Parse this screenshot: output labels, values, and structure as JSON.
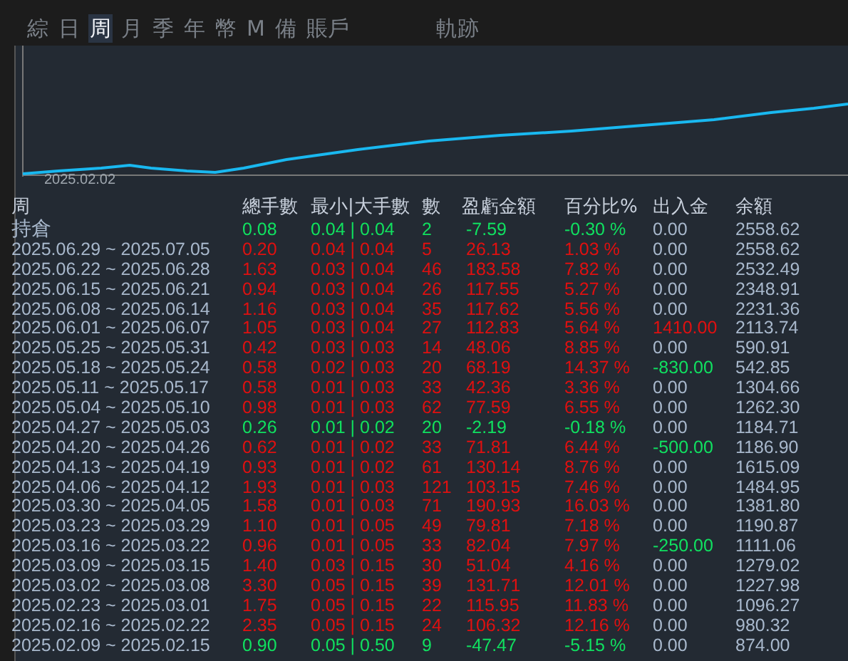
{
  "tabs": [
    {
      "label": "綜",
      "selected": false
    },
    {
      "label": "日",
      "selected": false
    },
    {
      "label": "周",
      "selected": true
    },
    {
      "label": "月",
      "selected": false
    },
    {
      "label": "季",
      "selected": false
    },
    {
      "label": "年",
      "selected": false
    },
    {
      "label": "幣",
      "selected": false
    },
    {
      "label": "M",
      "selected": false
    },
    {
      "label": "備",
      "selected": false
    },
    {
      "label": "賬戶",
      "selected": false
    },
    {
      "label": "軌跡",
      "selected": false
    }
  ],
  "chart": {
    "x_label": "2025.02.02"
  },
  "table": {
    "period_heading": "周",
    "columns": [
      "總手數",
      "最小|大手數",
      "數",
      "盈虧金額",
      "百分比%",
      "出入金",
      "余額"
    ],
    "rows": [
      {
        "week": "持倉",
        "total": "0.08",
        "min_max": "0.04 | 0.04",
        "count": "2",
        "pnl": "-7.59",
        "pct": "-0.30 %",
        "deposit": {
          "value": "0.00",
          "color": "#a8b8cc"
        },
        "balance": "2558.62",
        "color": "#10e060"
      },
      {
        "week": "2025.06.29 ~ 2025.07.05",
        "total": "0.20",
        "min_max": "0.04 | 0.04",
        "count": "5",
        "pnl": "26.13",
        "pct": "1.03 %",
        "deposit": {
          "value": "0.00",
          "color": "#a8b8cc"
        },
        "balance": "2558.62",
        "color": "#e01010"
      },
      {
        "week": "2025.06.22 ~ 2025.06.28",
        "total": "1.63",
        "min_max": "0.03 | 0.04",
        "count": "46",
        "pnl": "183.58",
        "pct": "7.82 %",
        "deposit": {
          "value": "0.00",
          "color": "#a8b8cc"
        },
        "balance": "2532.49",
        "color": "#e01010"
      },
      {
        "week": "2025.06.15 ~ 2025.06.21",
        "total": "0.94",
        "min_max": "0.03 | 0.04",
        "count": "26",
        "pnl": "117.55",
        "pct": "5.27 %",
        "deposit": {
          "value": "0.00",
          "color": "#a8b8cc"
        },
        "balance": "2348.91",
        "color": "#e01010"
      },
      {
        "week": "2025.06.08 ~ 2025.06.14",
        "total": "1.16",
        "min_max": "0.03 | 0.04",
        "count": "35",
        "pnl": "117.62",
        "pct": "5.56 %",
        "deposit": {
          "value": "0.00",
          "color": "#a8b8cc"
        },
        "balance": "2231.36",
        "color": "#e01010"
      },
      {
        "week": "2025.06.01 ~ 2025.06.07",
        "total": "1.05",
        "min_max": "0.03 | 0.04",
        "count": "27",
        "pnl": "112.83",
        "pct": "5.64 %",
        "deposit": {
          "value": "1410.00",
          "color": "#e01010"
        },
        "balance": "2113.74",
        "color": "#e01010"
      },
      {
        "week": "2025.05.25 ~ 2025.05.31",
        "total": "0.42",
        "min_max": "0.03 | 0.03",
        "count": "14",
        "pnl": "48.06",
        "pct": "8.85 %",
        "deposit": {
          "value": "0.00",
          "color": "#a8b8cc"
        },
        "balance": "590.91",
        "color": "#e01010"
      },
      {
        "week": "2025.05.18 ~ 2025.05.24",
        "total": "0.58",
        "min_max": "0.02 | 0.03",
        "count": "20",
        "pnl": "68.19",
        "pct": "14.37 %",
        "deposit": {
          "value": "-830.00",
          "color": "#10e060"
        },
        "balance": "542.85",
        "color": "#e01010"
      },
      {
        "week": "2025.05.11 ~ 2025.05.17",
        "total": "0.58",
        "min_max": "0.01 | 0.03",
        "count": "33",
        "pnl": "42.36",
        "pct": "3.36 %",
        "deposit": {
          "value": "0.00",
          "color": "#a8b8cc"
        },
        "balance": "1304.66",
        "color": "#e01010"
      },
      {
        "week": "2025.05.04 ~ 2025.05.10",
        "total": "0.98",
        "min_max": "0.01 | 0.03",
        "count": "62",
        "pnl": "77.59",
        "pct": "6.55 %",
        "deposit": {
          "value": "0.00",
          "color": "#a8b8cc"
        },
        "balance": "1262.30",
        "color": "#e01010"
      },
      {
        "week": "2025.04.27 ~ 2025.05.03",
        "total": "0.26",
        "min_max": "0.01 | 0.02",
        "count": "20",
        "pnl": "-2.19",
        "pct": "-0.18 %",
        "deposit": {
          "value": "0.00",
          "color": "#a8b8cc"
        },
        "balance": "1184.71",
        "color": "#10e060"
      },
      {
        "week": "2025.04.20 ~ 2025.04.26",
        "total": "0.62",
        "min_max": "0.01 | 0.02",
        "count": "33",
        "pnl": "71.81",
        "pct": "6.44 %",
        "deposit": {
          "value": "-500.00",
          "color": "#10e060"
        },
        "balance": "1186.90",
        "color": "#e01010"
      },
      {
        "week": "2025.04.13 ~ 2025.04.19",
        "total": "0.93",
        "min_max": "0.01 | 0.02",
        "count": "61",
        "pnl": "130.14",
        "pct": "8.76 %",
        "deposit": {
          "value": "0.00",
          "color": "#a8b8cc"
        },
        "balance": "1615.09",
        "color": "#e01010"
      },
      {
        "week": "2025.04.06 ~ 2025.04.12",
        "total": "1.93",
        "min_max": "0.01 | 0.03",
        "count": "121",
        "pnl": "103.15",
        "pct": "7.46 %",
        "deposit": {
          "value": "0.00",
          "color": "#a8b8cc"
        },
        "balance": "1484.95",
        "color": "#e01010"
      },
      {
        "week": "2025.03.30 ~ 2025.04.05",
        "total": "1.58",
        "min_max": "0.01 | 0.03",
        "count": "71",
        "pnl": "190.93",
        "pct": "16.03 %",
        "deposit": {
          "value": "0.00",
          "color": "#a8b8cc"
        },
        "balance": "1381.80",
        "color": "#e01010"
      },
      {
        "week": "2025.03.23 ~ 2025.03.29",
        "total": "1.10",
        "min_max": "0.01 | 0.05",
        "count": "49",
        "pnl": "79.81",
        "pct": "7.18 %",
        "deposit": {
          "value": "0.00",
          "color": "#a8b8cc"
        },
        "balance": "1190.87",
        "color": "#e01010"
      },
      {
        "week": "2025.03.16 ~ 2025.03.22",
        "total": "0.96",
        "min_max": "0.01 | 0.05",
        "count": "33",
        "pnl": "82.04",
        "pct": "7.97 %",
        "deposit": {
          "value": "-250.00",
          "color": "#10e060"
        },
        "balance": "1111.06",
        "color": "#e01010"
      },
      {
        "week": "2025.03.09 ~ 2025.03.15",
        "total": "1.40",
        "min_max": "0.03 | 0.15",
        "count": "30",
        "pnl": "51.04",
        "pct": "4.16 %",
        "deposit": {
          "value": "0.00",
          "color": "#a8b8cc"
        },
        "balance": "1279.02",
        "color": "#e01010"
      },
      {
        "week": "2025.03.02 ~ 2025.03.08",
        "total": "3.30",
        "min_max": "0.05 | 0.15",
        "count": "39",
        "pnl": "131.71",
        "pct": "12.01 %",
        "deposit": {
          "value": "0.00",
          "color": "#a8b8cc"
        },
        "balance": "1227.98",
        "color": "#e01010"
      },
      {
        "week": "2025.02.23 ~ 2025.03.01",
        "total": "1.75",
        "min_max": "0.05 | 0.15",
        "count": "22",
        "pnl": "115.95",
        "pct": "11.83 %",
        "deposit": {
          "value": "0.00",
          "color": "#a8b8cc"
        },
        "balance": "1096.27",
        "color": "#e01010"
      },
      {
        "week": "2025.02.16 ~ 2025.02.22",
        "total": "2.35",
        "min_max": "0.05 | 0.15",
        "count": "24",
        "pnl": "106.32",
        "pct": "12.16 %",
        "deposit": {
          "value": "0.00",
          "color": "#a8b8cc"
        },
        "balance": "980.32",
        "color": "#e01010"
      },
      {
        "week": "2025.02.09 ~ 2025.02.15",
        "total": "0.90",
        "min_max": "0.05 | 0.50",
        "count": "9",
        "pnl": "-47.47",
        "pct": "-5.15 %",
        "deposit": {
          "value": "0.00",
          "color": "#a8b8cc"
        },
        "balance": "874.00",
        "color": "#10e060"
      }
    ]
  }
}
